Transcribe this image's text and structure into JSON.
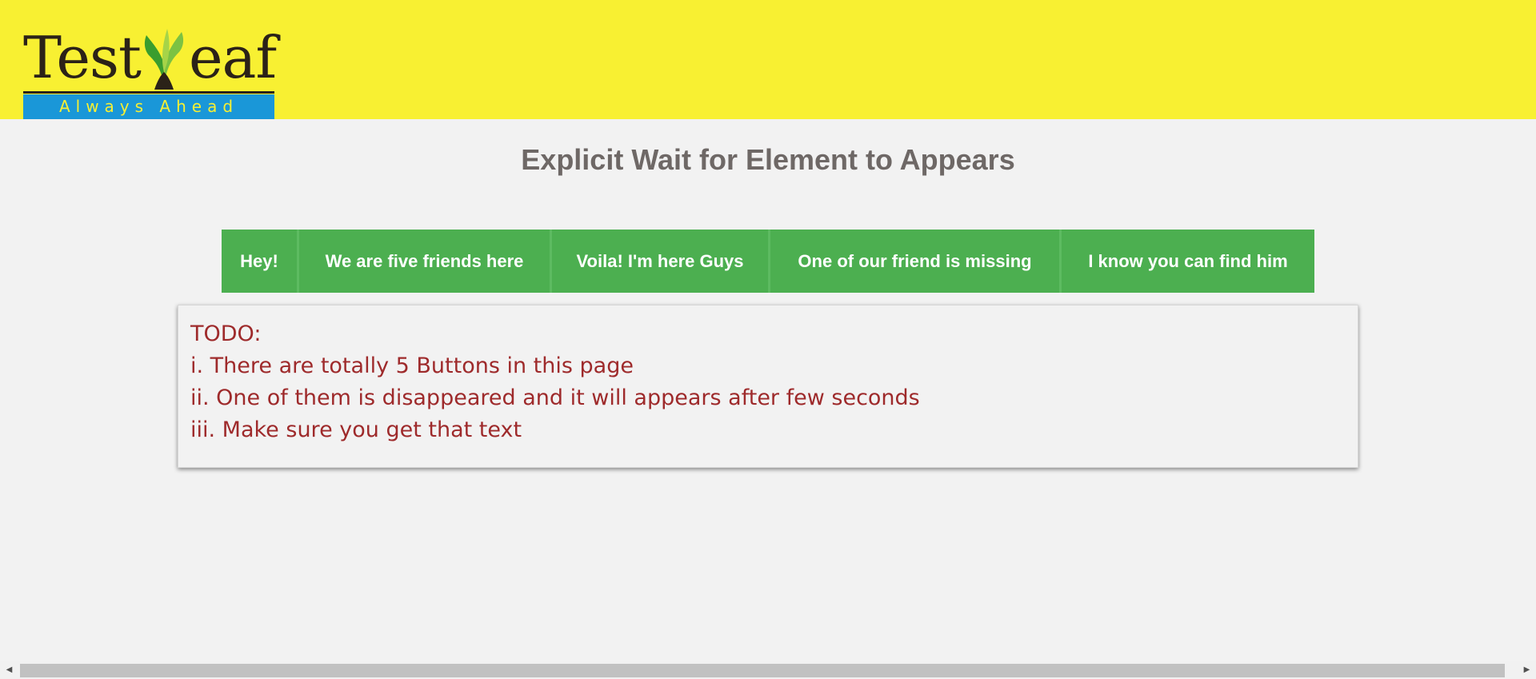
{
  "header": {
    "logo": {
      "word": "TestLeaf",
      "word_left": "Test",
      "word_right": "eaf",
      "tagline": "Always Ahead"
    },
    "colors": {
      "background": "#f8f032",
      "tagline_bg": "#1a97d8",
      "tagline_text": "#f8f032"
    }
  },
  "main": {
    "title": "Explicit Wait for Element to Appears",
    "buttons": [
      {
        "label": "Hey!"
      },
      {
        "label": "We are five friends here"
      },
      {
        "label": "Voila! I'm here Guys"
      },
      {
        "label": "One of our friend is missing"
      },
      {
        "label": "I know you can find him"
      }
    ],
    "todo": {
      "heading": "TODO:",
      "items": [
        "i. There are totally 5 Buttons in this page",
        "ii. One of them is disappeared and it will appears after few seconds",
        "iii. Make sure you get that text"
      ]
    }
  },
  "colors": {
    "page_bg": "#f2f2f2",
    "button_bg": "#4caf50",
    "title_text": "#6e6866",
    "todo_text": "#9e2a2b"
  },
  "scrollbar": {
    "left_arrow_icon": "arrow-left-icon",
    "right_arrow_icon": "arrow-right-icon"
  }
}
